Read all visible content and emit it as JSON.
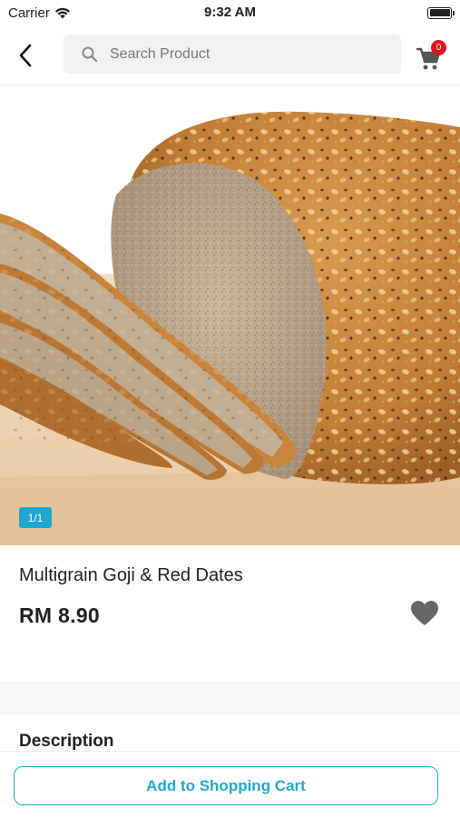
{
  "status_bar": {
    "carrier": "Carrier",
    "time": "9:32 AM"
  },
  "header": {
    "search_placeholder": "Search Product",
    "cart_count": "0"
  },
  "product": {
    "image_counter": "1/1",
    "name": "Multigrain Goji & Red Dates",
    "price": "RM 8.90",
    "wishlisted": false
  },
  "description": {
    "heading": "Description"
  },
  "actions": {
    "add_to_cart_label": "Add to Shopping Cart"
  },
  "colors": {
    "accent": "#1ea8cf",
    "badge": "#e4151f",
    "heart": "#666666"
  }
}
